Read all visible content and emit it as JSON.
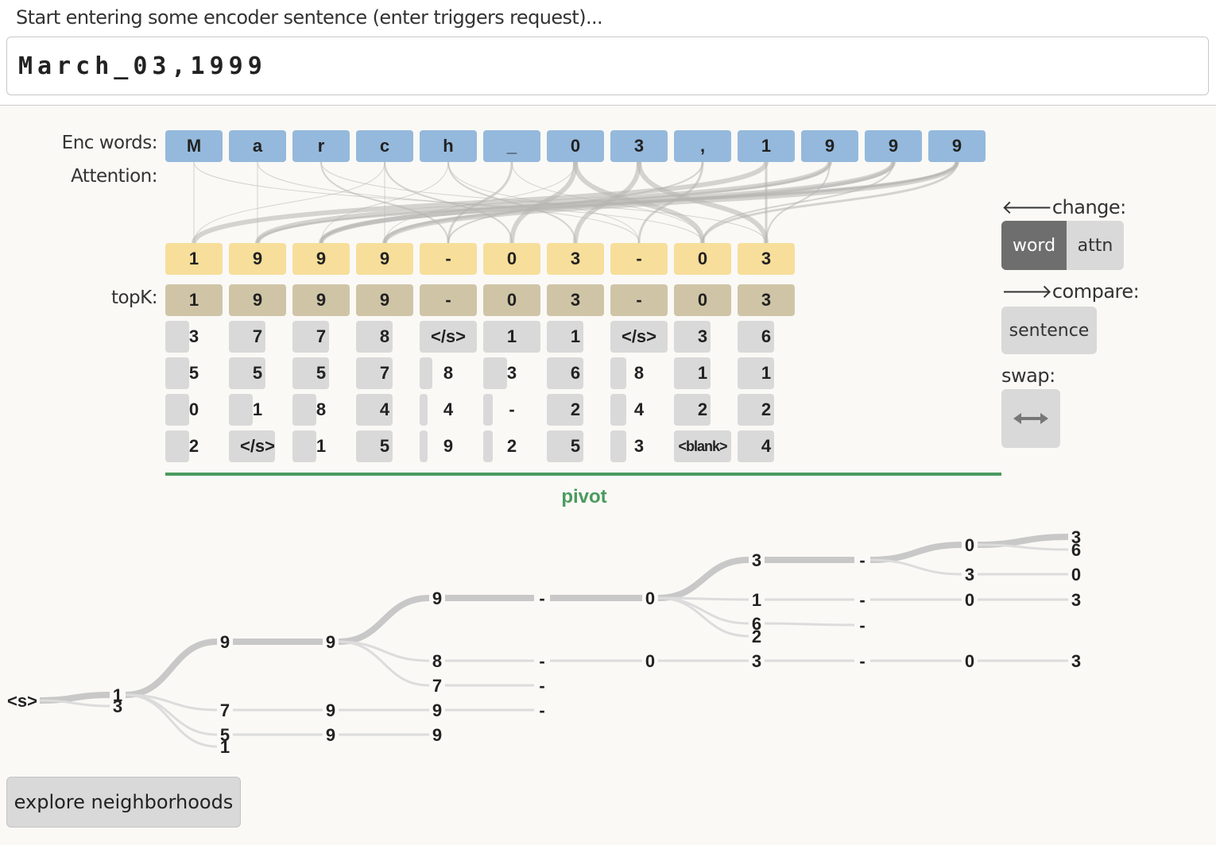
{
  "header": {
    "prompt": "Start entering some encoder sentence (enter triggers request)...",
    "input_value": "March_03,1999"
  },
  "labels": {
    "enc_words": "Enc words:",
    "attention": "Attention:",
    "topk": "topK:"
  },
  "enc_words": [
    "M",
    "a",
    "r",
    "c",
    "h",
    "_",
    "0",
    "3",
    ",",
    "1",
    "9",
    "9",
    "9"
  ],
  "decoder_words": [
    "1",
    "9",
    "9",
    "9",
    "-",
    "0",
    "3",
    "-",
    "0",
    "3"
  ],
  "topk": [
    [
      "1",
      "3",
      "5",
      "0",
      "2"
    ],
    [
      "9",
      "7",
      "5",
      "1",
      "</s>"
    ],
    [
      "9",
      "7",
      "5",
      "8",
      "1"
    ],
    [
      "9",
      "8",
      "7",
      "4",
      "5"
    ],
    [
      "-",
      "</s>",
      "8",
      "4",
      "9"
    ],
    [
      "0",
      "1",
      "3",
      "-",
      "2"
    ],
    [
      "3",
      "1",
      "6",
      "2",
      "5"
    ],
    [
      "-",
      "</s>",
      "8",
      "4",
      "3"
    ],
    [
      "0",
      "3",
      "1",
      "2",
      "<blank>"
    ],
    [
      "3",
      "6",
      "1",
      "2",
      "4"
    ]
  ],
  "pivot_label": "pivot",
  "controls": {
    "change_label": "change:",
    "change_arrow_icon": "arrow-left-icon",
    "word_label": "word",
    "attn_label": "attn",
    "compare_label": "compare:",
    "compare_arrow_icon": "arrow-right-icon",
    "sentence_label": "sentence",
    "swap_label": "swap:",
    "swap_icon": "swap-icon"
  },
  "beam_tree": {
    "start": "<s>",
    "nodes": [
      {
        "label": "1",
        "depth": 1
      },
      {
        "label": "3",
        "depth": 1
      },
      {
        "label": "9",
        "depth": 2
      },
      {
        "label": "7",
        "depth": 2
      },
      {
        "label": "5",
        "depth": 2
      },
      {
        "label": "1",
        "depth": 2
      },
      {
        "label": "9",
        "depth": 3
      },
      {
        "label": "9",
        "depth": 3
      },
      {
        "label": "9",
        "depth": 3
      },
      {
        "label": "9",
        "depth": 4
      },
      {
        "label": "8",
        "depth": 4
      },
      {
        "label": "7",
        "depth": 4
      },
      {
        "label": "9",
        "depth": 4
      },
      {
        "label": "9",
        "depth": 4
      },
      {
        "label": "-",
        "depth": 5
      },
      {
        "label": "-",
        "depth": 5
      },
      {
        "label": "-",
        "depth": 5
      },
      {
        "label": "-",
        "depth": 5
      },
      {
        "label": "0",
        "depth": 6
      },
      {
        "label": "0",
        "depth": 6
      },
      {
        "label": "3",
        "depth": 7
      },
      {
        "label": "1",
        "depth": 7
      },
      {
        "label": "6",
        "depth": 7
      },
      {
        "label": "2",
        "depth": 7
      },
      {
        "label": "3",
        "depth": 7
      },
      {
        "label": "-",
        "depth": 8
      },
      {
        "label": "-",
        "depth": 8
      },
      {
        "label": "-",
        "depth": 8
      },
      {
        "label": "-",
        "depth": 8
      },
      {
        "label": "0",
        "depth": 9
      },
      {
        "label": "3",
        "depth": 9
      },
      {
        "label": "0",
        "depth": 9
      },
      {
        "label": "0",
        "depth": 9
      },
      {
        "label": "3",
        "depth": 10
      },
      {
        "label": "6",
        "depth": 10
      },
      {
        "label": "0",
        "depth": 10
      },
      {
        "label": "3",
        "depth": 10
      },
      {
        "label": "3",
        "depth": 10
      }
    ]
  },
  "explore_button": "explore neighborhoods",
  "colors": {
    "encoder": "#94b9dc",
    "decoder": "#f7de9a",
    "top1": "#cfc5a6",
    "alternative": "#d9d9d9",
    "pivot": "#4a9a5e",
    "active_button": "#6e6e6e"
  }
}
